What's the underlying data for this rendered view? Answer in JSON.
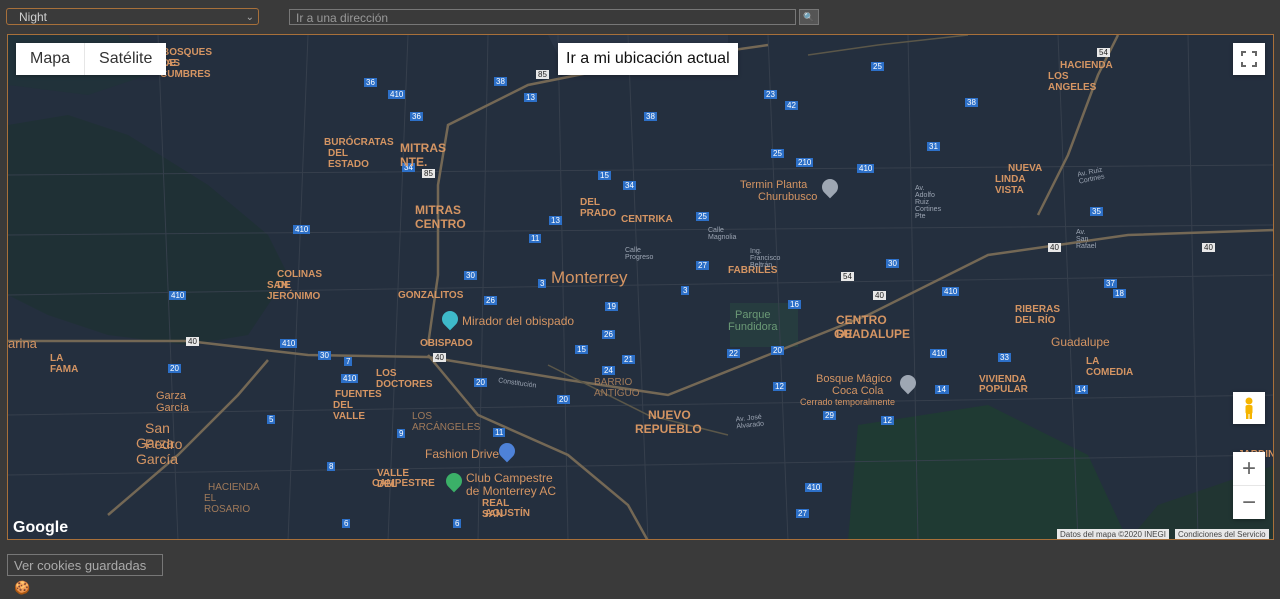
{
  "toolbar": {
    "style_value": "Night",
    "address_placeholder": "Ir a una dirección",
    "search_icon": "magnifier-icon"
  },
  "map": {
    "type_buttons": [
      "Mapa",
      "Satélite"
    ],
    "location_button": "Ir a mi ubicación actual",
    "zoom_in": "+",
    "zoom_out": "−",
    "google_logo": "Google",
    "attribution": "Datos del mapa ©2020 INEGI",
    "terms": "Condiciones del Servicio",
    "labels_major": [
      "Monterrey",
      "MITRAS NTE.",
      "MITRAS CENTRO",
      "CENTRO DE",
      "GUADALUPE",
      "NUEVO",
      "REPUEBLO",
      "San Pedro",
      "Garza García",
      "Guadalupe",
      "NUEVA",
      "LINDA VISTA",
      "HACIENDA",
      "LOS ANGELES",
      "BURÓCRATAS",
      "DEL ESTADO",
      "BOSQUES DE",
      "LAS CUMBRES",
      "COLINAS DE",
      "SAN JERÓNIMO",
      "GONZALITOS",
      "OBISPADO",
      "LOS DOCTORES",
      "FUENTES",
      "DEL VALLE",
      "LOS ARCÁNGELES",
      "BARRIO ANTIGUO",
      "DEL PRADO",
      "CENTRIKA",
      "FABRILES",
      "RIBERAS DEL RÍO",
      "LA COMEDIA",
      "VIVIENDA",
      "POPULAR",
      "VALLE DEL",
      "CAMPESTRE",
      "REAL SAN",
      "AGUSTÍN",
      "HACIENDA",
      "EL ROSARIO",
      "LA FAMA",
      "JARDINES",
      "Garza García",
      "arina"
    ],
    "pois": [
      {
        "name": "Termin Planta",
        "line2": "Churubusco"
      },
      {
        "name": "Mirador del obispado"
      },
      {
        "name": "Parque",
        "line2": "Fundidora"
      },
      {
        "name": "Bosque Mágico",
        "line2": "Coca Cola",
        "line3": "Cerrado temporalmente"
      },
      {
        "name": "Fashion Drive"
      },
      {
        "name": "Club Campestre",
        "line2": "de Monterrey AC"
      }
    ],
    "route_shields": [
      "36",
      "410",
      "36",
      "38",
      "85",
      "13",
      "38",
      "23",
      "42",
      "25",
      "210",
      "410",
      "31",
      "25",
      "38",
      "34",
      "85",
      "15",
      "34",
      "13",
      "11",
      "25",
      "27",
      "3",
      "30",
      "26",
      "3",
      "19",
      "26",
      "15",
      "21",
      "24",
      "16",
      "22",
      "20",
      "30",
      "40",
      "410",
      "37",
      "18",
      "410",
      "33",
      "14",
      "410",
      "40",
      "20",
      "20",
      "5",
      "9",
      "11",
      "8",
      "6",
      "6",
      "410",
      "27",
      "29",
      "12",
      "12",
      "14",
      "14",
      "20",
      "7",
      "410",
      "30",
      "40",
      "410",
      "54",
      "40",
      "40",
      "35",
      "54",
      "410"
    ],
    "streets": [
      "Av. Ruiz Cortines",
      "Constitución",
      "Av. José Alvarado",
      "Calle Progreso",
      "Calle Magnolia",
      "Ing. Francisco Beltrán",
      "Av. San Rafael",
      "Av. Adolfo Ruiz Cortines Pte"
    ]
  },
  "footer": {
    "cookies_label": "Ver cookies guardadas",
    "cookie_icon": "cookie-icon"
  },
  "colors": {
    "map_bg": "#242f3e",
    "water": "#17263c",
    "park": "#263c3f",
    "road": "#38414e",
    "highway": "#746855",
    "label": "#d59563",
    "shield": "#2d70c8"
  }
}
